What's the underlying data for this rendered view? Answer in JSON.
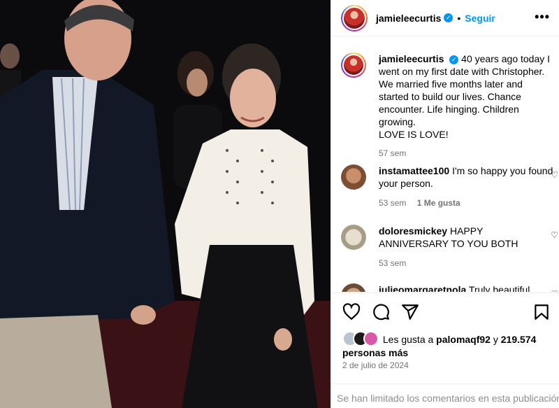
{
  "post": {
    "username": "jamieleecurtis",
    "follow_label": "Seguir",
    "caption_text": "40 years ago today I went on my first date with Christopher. We married five months later and started to build our lives. Chance encounter. Life hinging. Children growing.",
    "caption_last": "LOVE IS LOVE!",
    "caption_time": "57 sem"
  },
  "comments": [
    {
      "user": "instamattee100",
      "text": "I'm so happy you found your person.",
      "time": "53 sem",
      "likes": "1 Me gusta"
    },
    {
      "user": "doloresmickey",
      "text": "HAPPY ANNIVERSARY TO YOU BOTH",
      "time": "53 sem",
      "likes": ""
    },
    {
      "user": "julieomargaretnola",
      "text": "Truly beautiful",
      "time": "",
      "likes": ""
    }
  ],
  "likes": {
    "prefix": "Les gusta a",
    "user": "palomaqf92",
    "joiner": "y",
    "count": "219.574",
    "suffix": "personas más"
  },
  "date": "2 de julio de 2024",
  "footer": "Se han limitado los comentarios en esta publicación",
  "icons": {
    "more": "more-icon",
    "heart": "heart-icon",
    "comment": "comment-icon",
    "share": "share-icon",
    "save": "bookmark-icon",
    "verified": "verified-badge-icon"
  },
  "colors": {
    "link_blue": "#0095f6",
    "muted": "#737373",
    "border": "#efefef"
  }
}
